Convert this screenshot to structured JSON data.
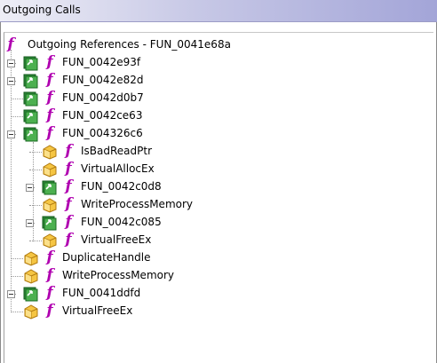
{
  "window": {
    "title": "Outgoing Calls"
  },
  "colors": {
    "function_glyph": "#b000b0",
    "title_gradient_end": "#a3a5d8"
  },
  "tree": {
    "root": {
      "label": "Outgoing References - FUN_0041e68a",
      "icon": "function-f-icon"
    },
    "nodes": [
      {
        "label": "FUN_0042e93f",
        "kind": "internal-function",
        "expandable": true
      },
      {
        "label": "FUN_0042e82d",
        "kind": "internal-function",
        "expandable": true
      },
      {
        "label": "FUN_0042d0b7",
        "kind": "internal-function",
        "expandable": false
      },
      {
        "label": "FUN_0042ce63",
        "kind": "internal-function",
        "expandable": false
      },
      {
        "label": "FUN_004326c6",
        "kind": "internal-function",
        "expandable": true,
        "expanded": true
      },
      {
        "label": "IsBadReadPtr",
        "kind": "external-function",
        "expandable": false
      },
      {
        "label": "VirtualAllocEx",
        "kind": "external-function",
        "expandable": false
      },
      {
        "label": "FUN_0042c0d8",
        "kind": "internal-function",
        "expandable": true
      },
      {
        "label": "WriteProcessMemory",
        "kind": "external-function",
        "expandable": false
      },
      {
        "label": "FUN_0042c085",
        "kind": "internal-function",
        "expandable": true
      },
      {
        "label": "VirtualFreeEx",
        "kind": "external-function",
        "expandable": false
      },
      {
        "label": "DuplicateHandle",
        "kind": "external-function",
        "expandable": false
      },
      {
        "label": "WriteProcessMemory",
        "kind": "external-function",
        "expandable": false
      },
      {
        "label": "FUN_0041ddfd",
        "kind": "internal-function",
        "expandable": true
      },
      {
        "label": "VirtualFreeEx",
        "kind": "external-function",
        "expandable": false
      }
    ]
  }
}
